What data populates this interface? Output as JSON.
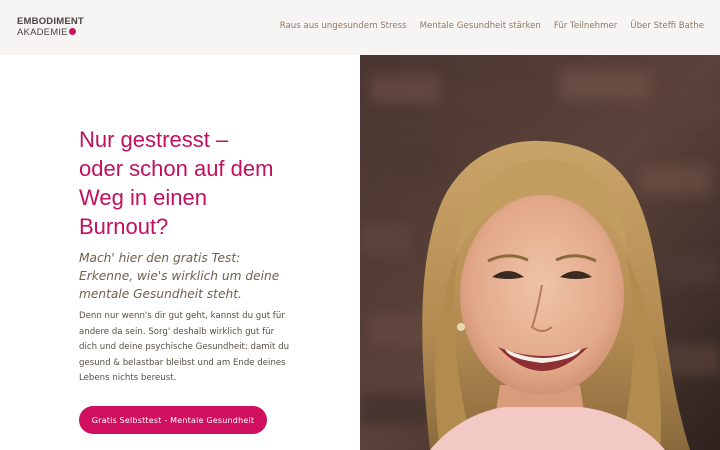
{
  "brand": {
    "line1": "EMBODIMENT",
    "line2": "AKADEMIE",
    "mark_color": "#d0105f"
  },
  "nav": {
    "items": [
      {
        "label": "Raus aus ungesundem Stress"
      },
      {
        "label": "Mentale Gesundheit stärken"
      },
      {
        "label": "Für Teilnehmer"
      },
      {
        "label": "Über Steffi Bathe"
      }
    ]
  },
  "hero": {
    "headline_lines": [
      "Nur gestresst –",
      "oder schon auf dem",
      "Weg in einen",
      "Burnout?"
    ],
    "subhead_lines": [
      "Mach' hier den gratis Test:",
      "Erkenne, wie's wirklich um deine",
      "mentale Gesundheit steht."
    ],
    "body_lines": [
      "Denn nur wenn's dir gut geht, kannst du gut für",
      "andere da sein. Sorg' deshalb wirklich gut für",
      "dich und deine psychische Gesundheit: damit du",
      "gesund & belastbar bleibst und am Ende deines",
      "Lebens nichts bereust."
    ],
    "cta_label": "Gratis Selbsttest - Mentale Gesundheit",
    "accent_color": "#c0105e"
  },
  "photo": {
    "icon": "portrait-photo"
  }
}
